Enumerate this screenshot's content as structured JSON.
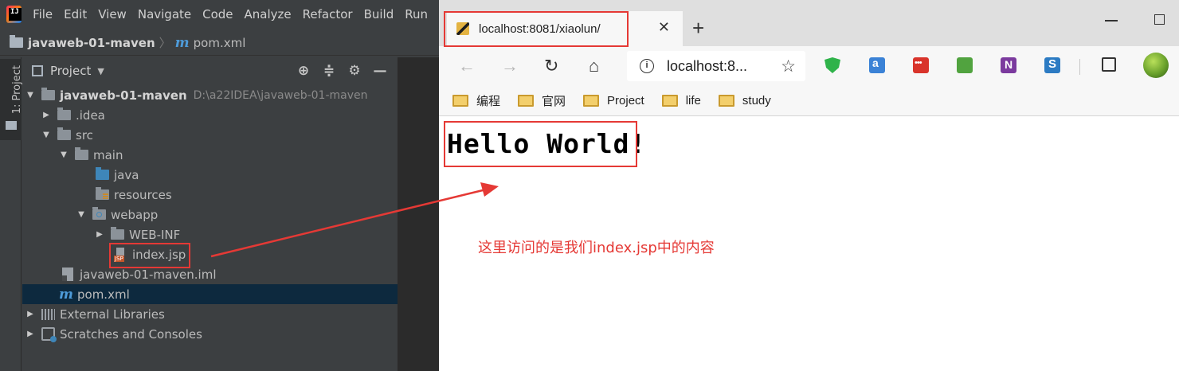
{
  "ide": {
    "menu": [
      "File",
      "Edit",
      "View",
      "Navigate",
      "Code",
      "Analyze",
      "Refactor",
      "Build",
      "Run"
    ],
    "breadcrumb": {
      "project": "javaweb-01-maven",
      "file": "pom.xml"
    },
    "side_tab": "1: Project",
    "panel_title": "Project",
    "tree": {
      "root": {
        "name": "javaweb-01-maven",
        "path": "D:\\a22IDEA\\javaweb-01-maven"
      },
      "idea": ".idea",
      "src": "src",
      "main": "main",
      "java": "java",
      "resources": "resources",
      "webapp": "webapp",
      "webinf": "WEB-INF",
      "indexjsp": "index.jsp",
      "iml": "javaweb-01-maven.iml",
      "pom": "pom.xml",
      "libs": "External Libraries",
      "scratches": "Scratches and Consoles"
    },
    "jsp_badge": "JSP"
  },
  "browser": {
    "tab_title": "localhost:8081/xiaolun/",
    "address": "localhost:8...",
    "favorites": [
      "编程",
      "官网",
      "Project",
      "life",
      "study"
    ],
    "page_text": "Hello World!"
  },
  "annotation": "这里访问的是我们index.jsp中的内容",
  "colors": {
    "annotation": "#e53935",
    "selection": "#0d293e",
    "ide_bg": "#3c3f41"
  }
}
